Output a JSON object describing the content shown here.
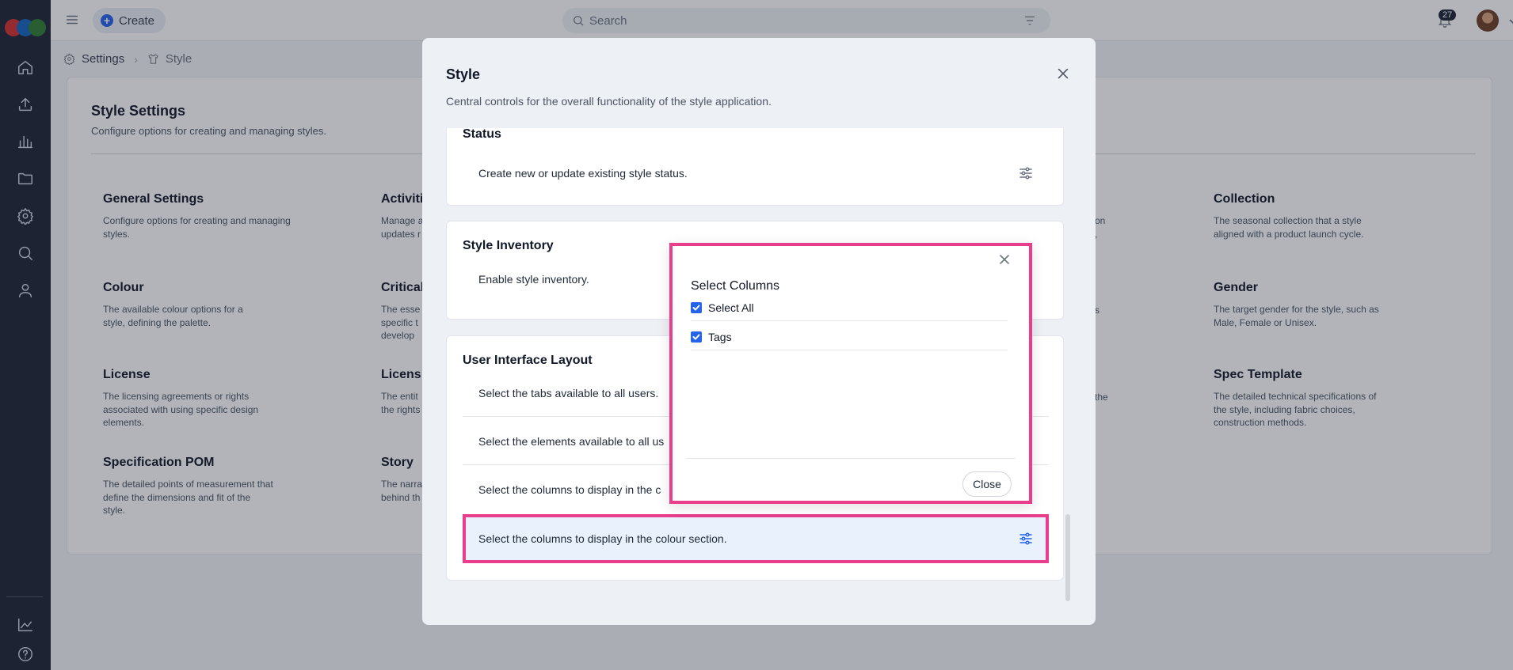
{
  "topbar": {
    "create_label": "Create",
    "search_placeholder": "Search",
    "notification_count": "27"
  },
  "sidebar": {
    "icons": [
      "home-icon",
      "upload-icon",
      "bar-chart-icon",
      "folder-icon",
      "gear-icon",
      "search-icon",
      "user-icon",
      "line-chart-icon",
      "help-icon"
    ],
    "logo_colors": [
      "#d32f2f",
      "#1565c0",
      "#2e7d32"
    ]
  },
  "breadcrumb": {
    "root": "Settings",
    "current": "Style"
  },
  "page": {
    "title": "Style Settings",
    "subtitle": "Configure options for creating and managing styles."
  },
  "settings": [
    {
      "title": "General Settings",
      "desc": "Configure options for creating and managing styles."
    },
    {
      "title": "Activiti",
      "desc": "Manage a updates r"
    },
    {
      "title": "Collection",
      "desc": "The seasonal collection that a style aligned with a product launch cycle."
    },
    {
      "title": "Colour",
      "desc": "The available colour options for a style, defining the palette."
    },
    {
      "title": "Critical",
      "desc": "The esse specific t develop"
    },
    {
      "title": "Gender",
      "desc": "The target gender for the style, such as Male, Female or Unisex."
    },
    {
      "title": "License",
      "desc": "The licensing agreements or rights associated with using specific design elements."
    },
    {
      "title": "Licens",
      "desc": "The entit the rights"
    },
    {
      "title": "Spec Template",
      "desc": "The detailed technical specifications of the style, including fabric choices, construction methods."
    },
    {
      "title": "Specification POM",
      "desc": "The detailed points of measurement that define the dimensions and fit of the style."
    },
    {
      "title": "Story",
      "desc": "The narra behind th"
    }
  ],
  "partial_text": {
    "col3_a": "on",
    "col3_b": ",",
    "col3_c": "s",
    "col3_d": "the"
  },
  "modal": {
    "title": "Style",
    "subtitle": "Central controls for the overall functionality of the style application.",
    "sections": {
      "status": {
        "title": "Status",
        "row": "Create new or update existing style status."
      },
      "inventory": {
        "title": "Style Inventory",
        "row": "Enable style inventory."
      },
      "ui_layout": {
        "title": "User Interface Layout",
        "rows": [
          "Select the tabs available to all users.",
          "Select the elements available to all us",
          "Select the columns to display in the c",
          "Select the columns to display in the colour section."
        ]
      }
    }
  },
  "popup": {
    "title": "Select Columns",
    "options": [
      "Select All",
      "Tags"
    ],
    "close_label": "Close"
  }
}
